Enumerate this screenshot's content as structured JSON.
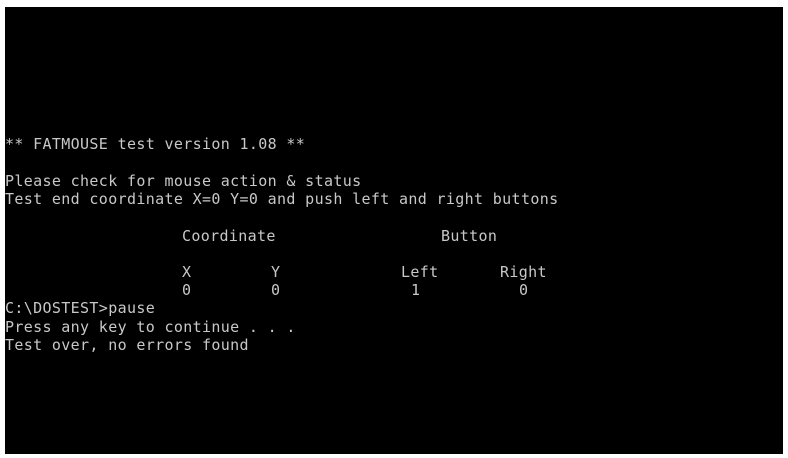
{
  "console": {
    "title_line": "** FATMOUSE test version 1.08 **",
    "instruction_1": "Please check for mouse action & status",
    "instruction_2": "Test end coordinate X=0 Y=0 and push left and right buttons",
    "table": {
      "coordinate_header": "Coordinate",
      "button_header": "Button",
      "x_label": "X",
      "y_label": "Y",
      "left_label": "Left",
      "right_label": "Right",
      "x_value": "0",
      "y_value": "0",
      "left_value": "1",
      "right_value": "0"
    },
    "prompt_line": "C:\\DOSTEST>pause",
    "press_key_line": "Press any key to continue . . .",
    "result_line": "Test over, no errors found"
  },
  "colors": {
    "screen_background": "#000000",
    "text": "#c8c8c8"
  }
}
